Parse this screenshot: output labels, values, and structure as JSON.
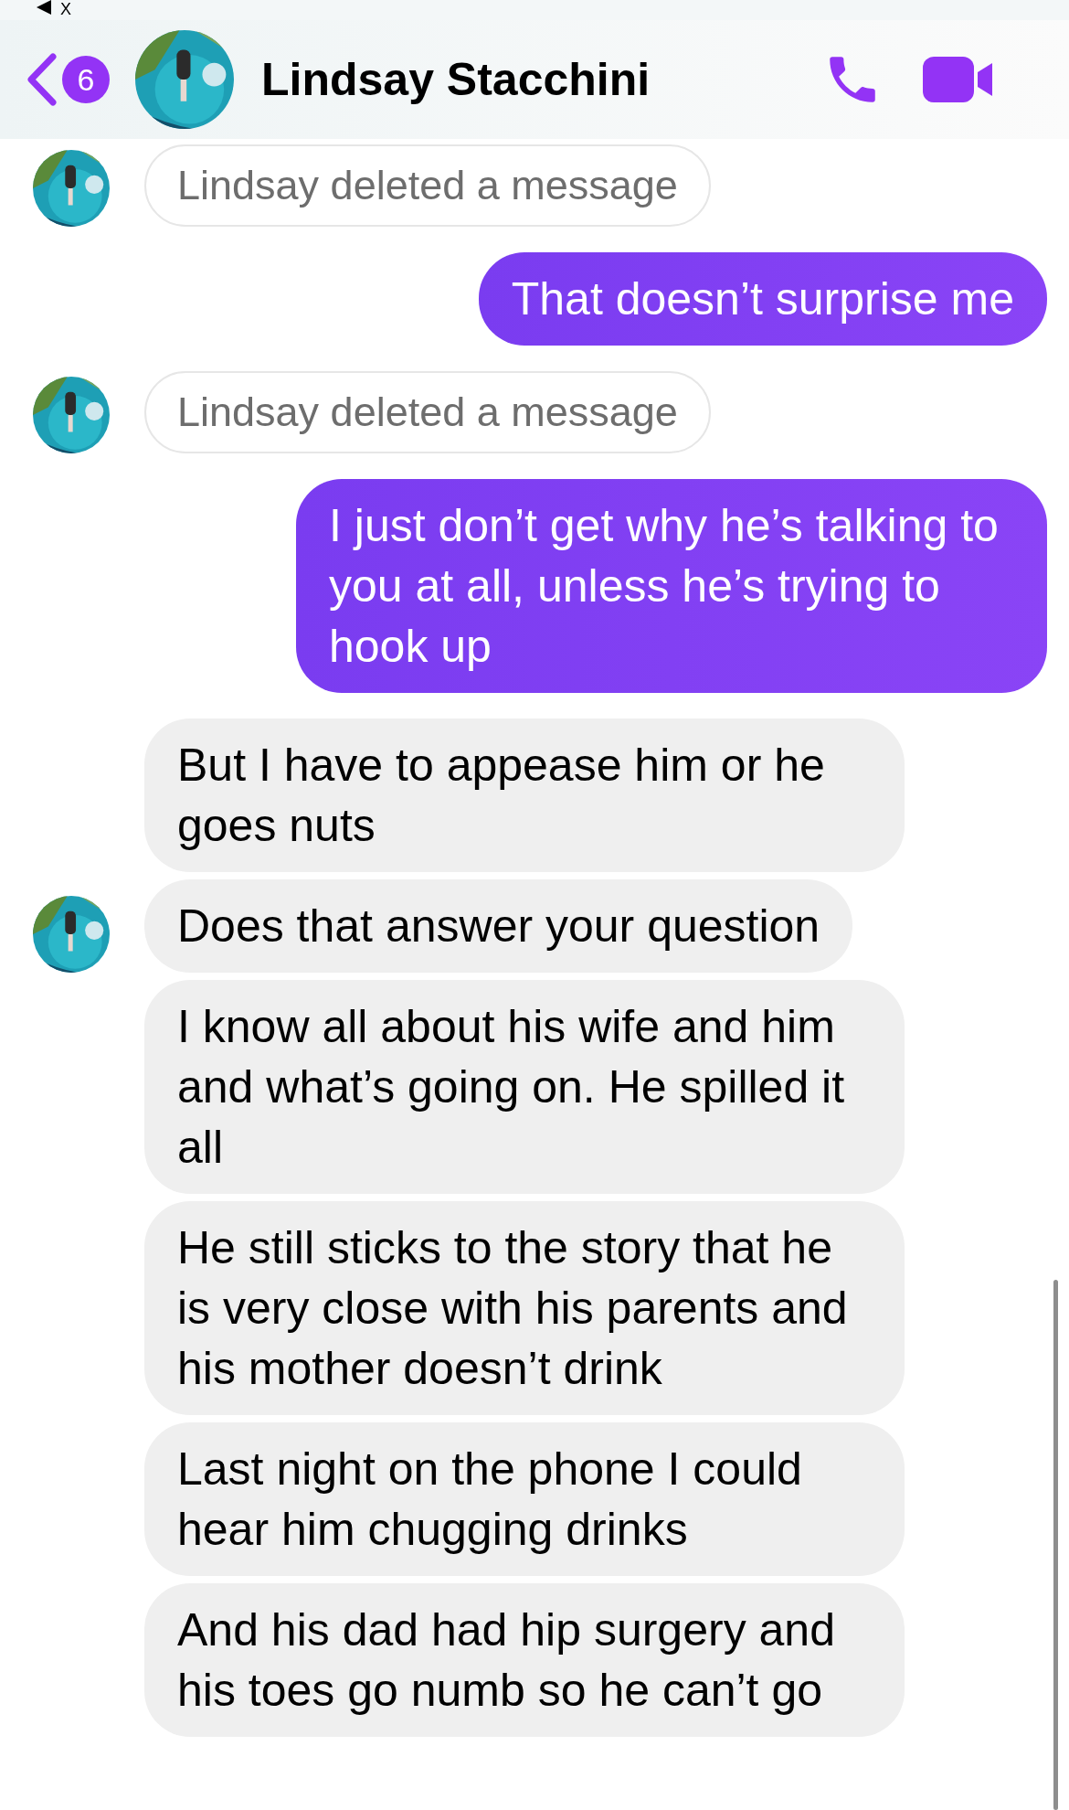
{
  "status_bar": {
    "back_label": "X"
  },
  "header": {
    "unread_count": "6",
    "contact_name": "Lindsay Stacchini"
  },
  "messages": [
    {
      "kind": "deleted",
      "text": "Lindsay deleted a message",
      "avatar": true
    },
    {
      "kind": "outgoing",
      "text": "That doesn’t surprise me",
      "avatar": false
    },
    {
      "kind": "deleted",
      "text": "Lindsay deleted a message",
      "avatar": true
    },
    {
      "kind": "outgoing",
      "text": "I just don’t get why he’s talking to you at all, unless he’s trying to hook up",
      "avatar": false
    },
    {
      "kind": "incoming",
      "text": "But I have to appease him or he goes nuts",
      "avatar": false
    },
    {
      "kind": "incoming",
      "text": "Does that answer your question",
      "avatar": true
    },
    {
      "kind": "incoming",
      "text": "I know all about his wife and him and what’s going on. He spilled it all",
      "avatar": false
    },
    {
      "kind": "incoming",
      "text": "He still sticks to the story that he is very close with his parents and his mother doesn’t drink",
      "avatar": false
    },
    {
      "kind": "incoming",
      "text": "Last night on the phone I could hear him chugging drinks",
      "avatar": false
    },
    {
      "kind": "incoming",
      "text": "And his dad had hip surgery and his toes go numb so he can’t go",
      "avatar": false
    }
  ]
}
